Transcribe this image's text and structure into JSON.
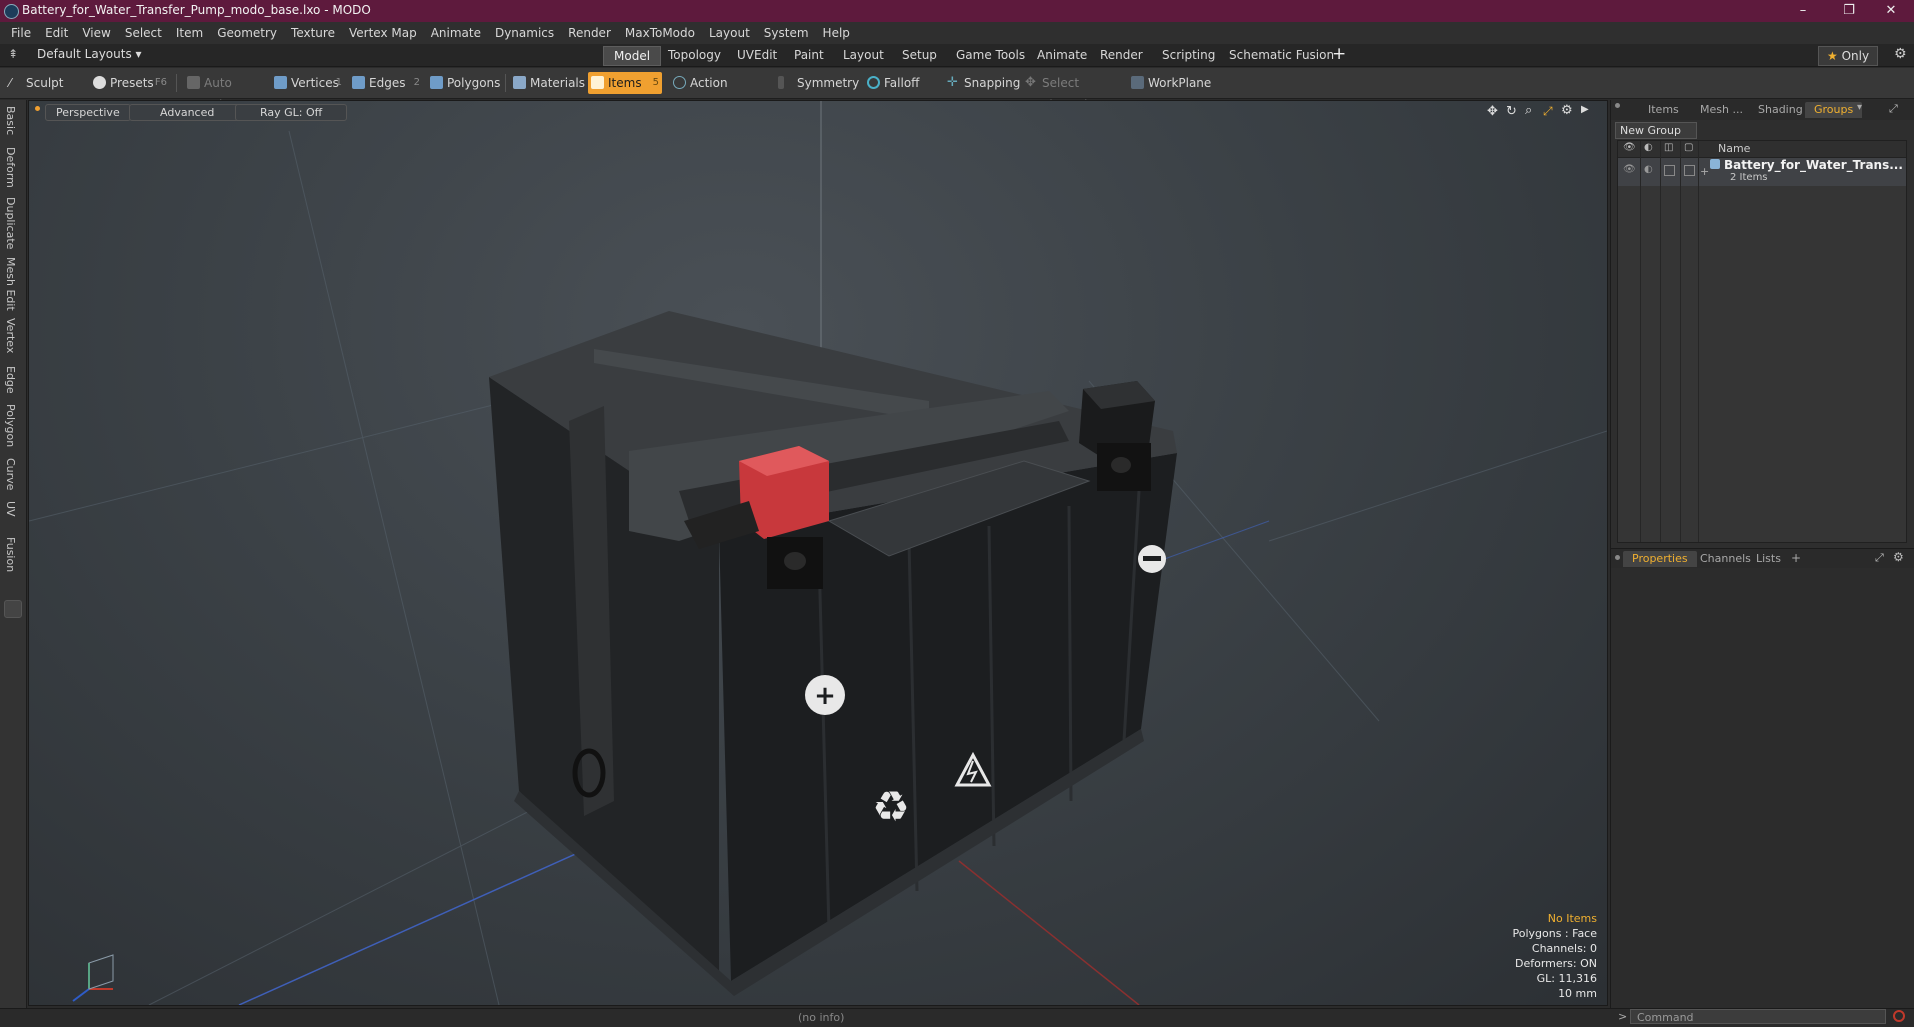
{
  "window": {
    "title": "Battery_for_Water_Transfer_Pump_modo_base.lxo - MODO",
    "controls": [
      "–",
      "❐",
      "✕"
    ]
  },
  "menubar": [
    "File",
    "Edit",
    "View",
    "Select",
    "Item",
    "Geometry",
    "Texture",
    "Vertex Map",
    "Animate",
    "Dynamics",
    "Render",
    "MaxToModo",
    "Layout",
    "System",
    "Help"
  ],
  "layouts": {
    "dropdown": "Default Layouts",
    "tabs": [
      "Model",
      "Topology",
      "UVEdit",
      "Paint",
      "Layout",
      "Setup",
      "Game Tools",
      "Animate",
      "Render",
      "Scripting",
      "Schematic Fusion"
    ],
    "active": "Model",
    "add": "+",
    "only": "Only"
  },
  "toolbar": {
    "sculpt": "Sculpt",
    "presets": "Presets",
    "presets_key": "F6",
    "auto_select": "Auto Select",
    "vertices": "Vertices",
    "vertices_key": "1",
    "edges": "Edges",
    "edges_key": "2",
    "polygons": "Polygons",
    "materials": "Materials",
    "items": "Items",
    "items_key": "5",
    "action_center": "Action Center",
    "symmetry": "Symmetry",
    "falloff": "Falloff",
    "snapping": "Snapping",
    "select_through": "Select Through",
    "workplane": "WorkPlane"
  },
  "left_tabs": [
    "Basic",
    "Deform",
    "Duplicate",
    "Mesh Edit",
    "Vertex",
    "Edge",
    "Polygon",
    "Curve",
    "UV",
    "Fusion"
  ],
  "viewport": {
    "view": "Perspective",
    "shading": "Advanced",
    "raygl": "Ray GL: Off",
    "hud": {
      "selection": "No Items",
      "polygons": "Polygons : Face",
      "channels": "Channels: 0",
      "deformers": "Deformers: ON",
      "gl": "GL: 11,316",
      "unit": "10 mm"
    }
  },
  "right_panel": {
    "tabs": [
      "Items",
      "Mesh ...",
      "Shading",
      "Groups"
    ],
    "active_tab": "Groups",
    "new_group": "New Group",
    "col_name": "Name",
    "group_name": "Battery_for_Water_Trans...",
    "group_count": "2 Items",
    "lower_tabs": [
      "Properties",
      "Channels",
      "Lists"
    ],
    "lower_active": "Properties",
    "lower_add": "+"
  },
  "status": {
    "info": "(no info)",
    "command_placeholder": "Command"
  },
  "colors": {
    "titlebar": "#5e1a3d",
    "accent": "#f0a030",
    "viewport_bg": "#3b4146"
  }
}
